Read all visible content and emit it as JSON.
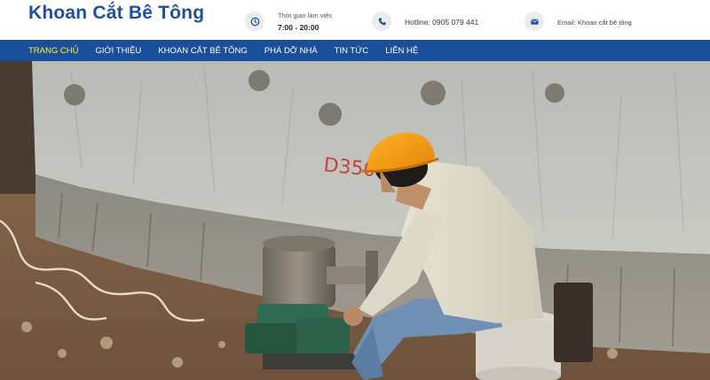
{
  "site": {
    "logo_text": "Khoan Cắt Bê Tông"
  },
  "header_info": {
    "hours": {
      "label": "Thời gian làm việc",
      "value": "7:00 - 20:00",
      "icon": "clock-icon"
    },
    "hotline": {
      "text": "Hotline: 0905 079 441",
      "icon": "phone-icon"
    },
    "email": {
      "text": "Email: Khoan cắt bê tông",
      "icon": "envelope-icon"
    }
  },
  "nav": {
    "items": [
      {
        "label": "TRANG CHỦ",
        "active": true
      },
      {
        "label": "GIỚI THIỆU",
        "active": false
      },
      {
        "label": "KHOAN CẮT BÊ TÔNG",
        "active": false
      },
      {
        "label": "PHÁ DỠ NHÀ",
        "active": false
      },
      {
        "label": "TIN TỨC",
        "active": false
      },
      {
        "label": "LIÊN HỆ",
        "active": false
      }
    ]
  },
  "hero": {
    "wall_marking": "D350"
  },
  "colors": {
    "brand_blue": "#1f4fa0",
    "nav_bg": "#1a4f9c",
    "nav_active": "#ffef3a",
    "helmet": "#f59a10"
  }
}
